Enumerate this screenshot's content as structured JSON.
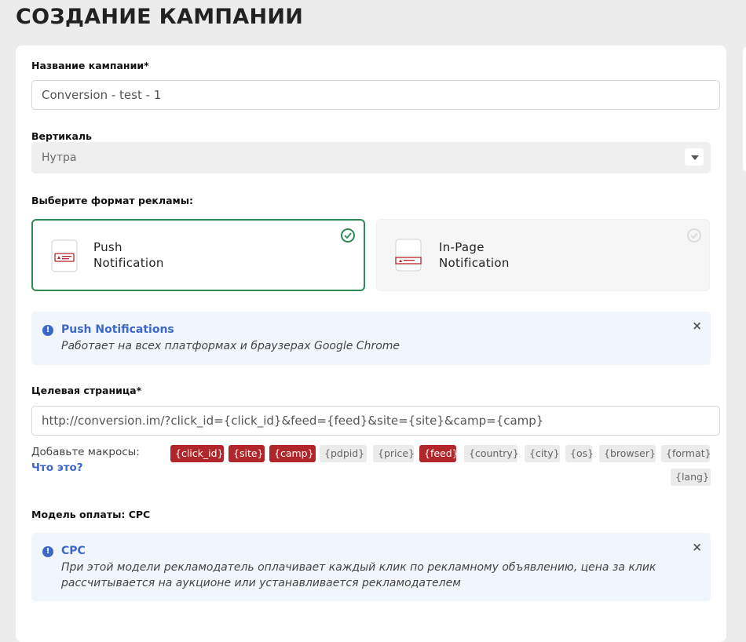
{
  "page": {
    "title": "СОЗДАНИЕ КАМПАНИИ"
  },
  "campaign_name": {
    "label": "Название кампании*",
    "value": "Conversion - test - 1"
  },
  "vertical": {
    "label": "Вертикаль",
    "value": "Нутра"
  },
  "ad_format": {
    "label": "Выберите формат рекламы:",
    "options": [
      {
        "line1": "Push",
        "line2": "Notification",
        "selected": true
      },
      {
        "line1": "In-Page",
        "line2": "Notification",
        "selected": false
      }
    ]
  },
  "format_info": {
    "title": "Push Notifications",
    "text": "Работает на всех платформах и браузерах Google Chrome",
    "icon": "!",
    "close": "×"
  },
  "target_page": {
    "label": "Целевая страница*",
    "value": "http://conversion.im/?click_id={click_id}&feed={feed}&site={site}&camp={camp}"
  },
  "macros": {
    "label": "Добавьте макросы:",
    "help": "Что это?",
    "items": [
      {
        "text": "{click_id}",
        "active": true
      },
      {
        "text": "{site}",
        "active": true
      },
      {
        "text": "{camp}",
        "active": true
      },
      {
        "text": "{pdpid}",
        "active": false
      },
      {
        "text": "{price}",
        "active": false
      },
      {
        "text": "{feed}",
        "active": true
      },
      {
        "text": "{country}",
        "active": false
      },
      {
        "text": "{city}",
        "active": false
      },
      {
        "text": "{os}",
        "active": false
      },
      {
        "text": "{browser}",
        "active": false
      },
      {
        "text": "{format}",
        "active": false
      },
      {
        "text": "{lang}",
        "active": false
      }
    ]
  },
  "payment_model": {
    "label": "Модель оплаты: CPC"
  },
  "cpc_info": {
    "title": "CPC",
    "text": "При этой модели рекламодатель оплачивает каждый клик по рекламному объявлению, цена за клик рассчитывается на аукционе или устанавливается рекламодателем",
    "icon": "!",
    "close": "×"
  },
  "colors": {
    "accent_green": "#2e8a55",
    "macro_active": "#b0262a",
    "info_blue": "#3c68c8"
  }
}
